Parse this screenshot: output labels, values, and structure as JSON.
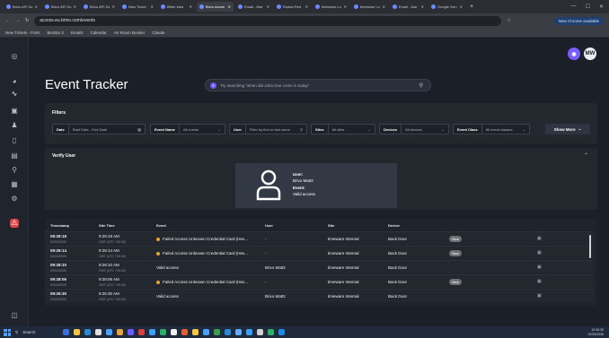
{
  "browser": {
    "tabs": [
      {
        "label": "Brivo API Dc",
        "active": false
      },
      {
        "label": "Brivo API Dc",
        "active": false
      },
      {
        "label": "Brivo API Dc",
        "active": false
      },
      {
        "label": "New Ticket",
        "active": false
      },
      {
        "label": "Bitter Idea",
        "active": false
      },
      {
        "label": "Brivo Acces",
        "active": true
      },
      {
        "label": "Email - Mar",
        "active": false
      },
      {
        "label": "Rudan Red",
        "active": false
      },
      {
        "label": "timeware Lo",
        "active": false
      },
      {
        "label": "timeware Lo",
        "active": false
      },
      {
        "label": "Email - Mar",
        "active": false
      },
      {
        "label": "Google Gen",
        "active": false
      }
    ],
    "new_tab": "+",
    "url": "access.eu.brivo.com/events",
    "update_label": "New Chrome available",
    "bookmarks": [
      "New Tickets - FUKI",
      "BioStar 2",
      "Emails",
      "Calendar",
      "AV Room Booker",
      "Claude"
    ]
  },
  "header": {
    "avatar_initials": "MW",
    "title": "Event Tracker",
    "search_placeholder": "Try searching \"when did John Doe come in today\""
  },
  "filters": {
    "heading": "Filters",
    "items": [
      {
        "label": "Date",
        "value": "Start Date - End Date"
      },
      {
        "label": "Event Name",
        "value": "All events"
      },
      {
        "label": "User",
        "value": "Filter by first or last name"
      },
      {
        "label": "Sites",
        "value": "All sites"
      },
      {
        "label": "Devices",
        "value": "All devices"
      },
      {
        "label": "Event Class",
        "value": "All event classes"
      }
    ],
    "show_more": "Show More"
  },
  "verify": {
    "heading": "Verify User",
    "user_label": "User:",
    "user_value": "Brivo Matt2",
    "event_label": "Event:",
    "event_value": "Valid access"
  },
  "table": {
    "columns": [
      "Timestamp",
      "Site Time",
      "Event",
      "User",
      "Site",
      "Device"
    ],
    "rows": [
      {
        "ts": "09:28:18",
        "date": "02/03/2026",
        "site_time": "9:28:18 AM",
        "tz": "GMT (UTC +00:00)",
        "event": "Failed Access Unknown Credential Card (Hex...",
        "warn": true,
        "user": "-",
        "site": "timeware Internal",
        "device": "Back Door",
        "badge": "New"
      },
      {
        "ts": "09:28:14",
        "date": "02/03/2026",
        "site_time": "9:28:14 AM",
        "tz": "GMT (UTC +00:00)",
        "event": "Failed Access Unknown Credential Card (Hex...",
        "warn": true,
        "user": "-",
        "site": "timeware Internal",
        "device": "Back Door",
        "badge": "New"
      },
      {
        "ts": "09:28:10",
        "date": "02/03/2026",
        "site_time": "9:28:10 AM",
        "tz": "GMT (UTC +00:00)",
        "event": "Valid access",
        "warn": false,
        "user": "Brivo Matt2",
        "site": "timeware Internal",
        "device": "Back Door",
        "badge": ""
      },
      {
        "ts": "09:28:06",
        "date": "02/03/2026",
        "site_time": "9:28:06 AM",
        "tz": "GMT (UTC +00:00)",
        "event": "Failed Access Unknown Credential Card (Hex...",
        "warn": true,
        "user": "-",
        "site": "timeware Internal",
        "device": "Back Door",
        "badge": "New"
      },
      {
        "ts": "09:26:30",
        "date": "02/03/2026",
        "site_time": "9:26:30 AM",
        "tz": "GMT (UTC +00:00)",
        "event": "Valid access",
        "warn": false,
        "user": "Brivo Matt2",
        "site": "timeware Internal",
        "device": "Back Door",
        "badge": ""
      }
    ]
  },
  "taskbar": {
    "search": "Search",
    "time": "10:30:33",
    "date": "02/03/2026"
  },
  "colors": {
    "accent_purple": "#7b5cff",
    "warning_dot": "#e8a33a",
    "nav_red": "#e04848"
  }
}
